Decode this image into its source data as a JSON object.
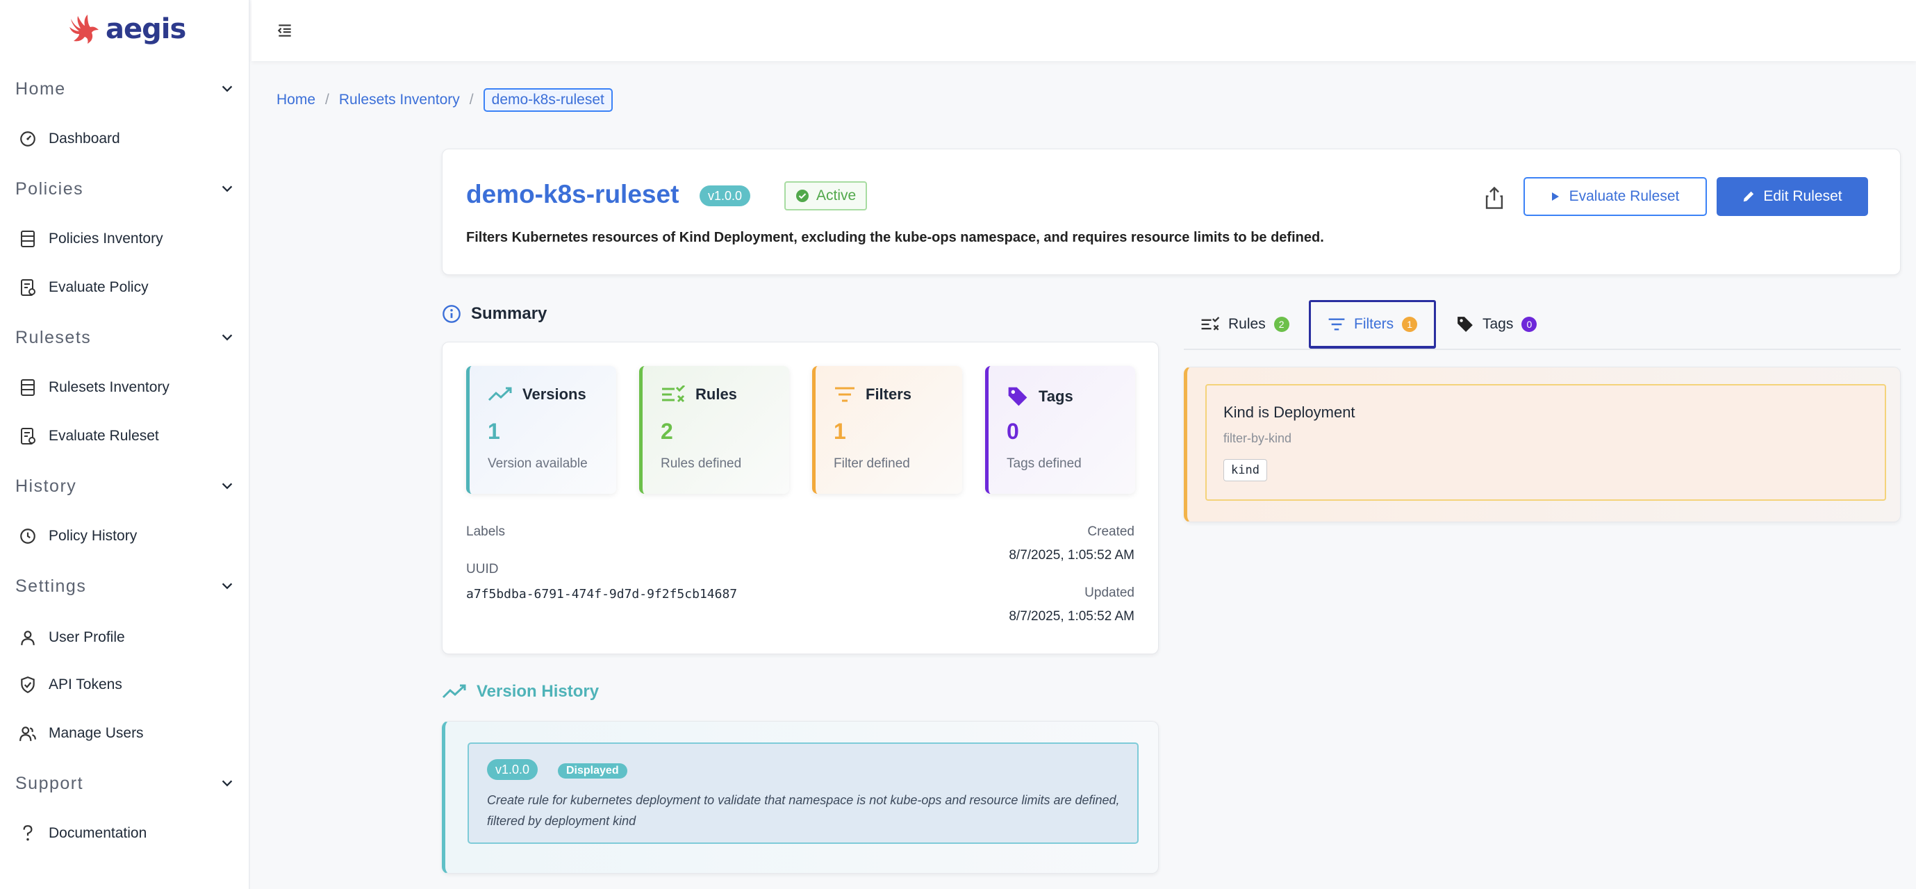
{
  "app": {
    "logo_text": "aegis"
  },
  "sidebar": {
    "groups": [
      {
        "title": "Home",
        "items": [
          {
            "label": "Dashboard",
            "icon": "gauge-icon"
          }
        ]
      },
      {
        "title": "Policies",
        "items": [
          {
            "label": "Policies Inventory",
            "icon": "list-icon"
          },
          {
            "label": "Evaluate Policy",
            "icon": "document-check-icon"
          }
        ]
      },
      {
        "title": "Rulesets",
        "items": [
          {
            "label": "Rulesets Inventory",
            "icon": "list-icon"
          },
          {
            "label": "Evaluate Ruleset",
            "icon": "document-check-icon"
          }
        ]
      },
      {
        "title": "History",
        "items": [
          {
            "label": "Policy History",
            "icon": "history-icon"
          }
        ]
      },
      {
        "title": "Settings",
        "items": [
          {
            "label": "User Profile",
            "icon": "user-icon"
          },
          {
            "label": "API Tokens",
            "icon": "shield-icon"
          },
          {
            "label": "Manage Users",
            "icon": "users-icon"
          }
        ]
      },
      {
        "title": "Support",
        "items": [
          {
            "label": "Documentation",
            "icon": "question-icon"
          }
        ]
      }
    ]
  },
  "breadcrumb": {
    "home": "Home",
    "inventory": "Rulesets Inventory",
    "current": "demo-k8s-ruleset",
    "separator": "/"
  },
  "ruleset": {
    "name": "demo-k8s-ruleset",
    "version": "v1.0.0",
    "status": "Active",
    "description": "Filters Kubernetes resources of Kind Deployment, excluding the kube-ops namespace, and requires resource limits to be defined.",
    "evaluate_label": "Evaluate Ruleset",
    "edit_label": "Edit Ruleset"
  },
  "summary": {
    "title": "Summary",
    "stats": [
      {
        "title": "Versions",
        "value": "1",
        "sub": "Version available",
        "color": "#4fb3b8",
        "icon": "trend-icon"
      },
      {
        "title": "Rules",
        "value": "2",
        "sub": "Rules defined",
        "color": "#6cc04a",
        "icon": "rules-icon"
      },
      {
        "title": "Filters",
        "value": "1",
        "sub": "Filter defined",
        "color": "#f2a93b",
        "icon": "filter-icon"
      },
      {
        "title": "Tags",
        "value": "0",
        "sub": "Tags defined",
        "color": "#6d28d9",
        "icon": "tag-icon"
      }
    ],
    "labels_label": "Labels",
    "uuid_label": "UUID",
    "uuid": "a7f5bdba-6791-474f-9d7d-9f2f5cb14687",
    "created_label": "Created",
    "created": "8/7/2025, 1:05:52 AM",
    "updated_label": "Updated",
    "updated": "8/7/2025, 1:05:52 AM"
  },
  "version_history": {
    "title": "Version History",
    "entries": [
      {
        "version": "v1.0.0",
        "badge": "Displayed",
        "message": "Create rule for kubernetes deployment to validate that namespace is not kube-ops and resource limits are defined, filtered by deployment kind"
      }
    ]
  },
  "tabs": [
    {
      "label": "Rules",
      "count": "2",
      "color": "#6cc04a",
      "icon": "rules-icon"
    },
    {
      "label": "Filters",
      "count": "1",
      "color": "#f2a93b",
      "icon": "filter-icon",
      "active": true
    },
    {
      "label": "Tags",
      "count": "0",
      "color": "#6d28d9",
      "icon": "tag-icon"
    }
  ],
  "filters": [
    {
      "name": "Kind is Deployment",
      "id": "filter-by-kind",
      "field": "kind"
    }
  ],
  "colors": {
    "accent": "#3b6fd8",
    "teal": "#5fc0c7",
    "active_green": "#51a84b"
  }
}
